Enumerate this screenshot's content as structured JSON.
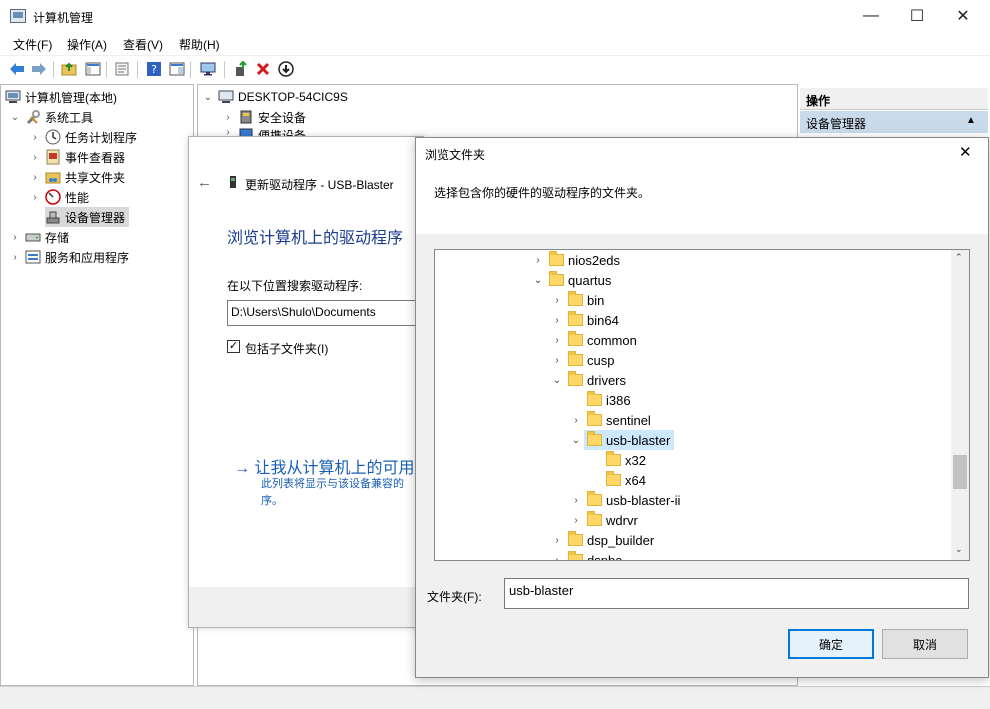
{
  "window": {
    "title": "计算机管理",
    "min_glyph": "—",
    "max_glyph": "☐",
    "close_glyph": "✕"
  },
  "menu": [
    "文件(F)",
    "操作(A)",
    "查看(V)",
    "帮助(H)"
  ],
  "left_tree": {
    "root": "计算机管理(本地)",
    "system_tools": "系统工具",
    "task_scheduler": "任务计划程序",
    "event_viewer": "事件查看器",
    "shared_folders": "共享文件夹",
    "performance": "性能",
    "device_manager": "设备管理器",
    "storage": "存储",
    "services_apps": "服务和应用程序"
  },
  "middle_tree": {
    "computer": "DESKTOP-54CIC9S",
    "security_devices": "安全设备",
    "portable_devices": "便携设备"
  },
  "actions": {
    "header": "操作",
    "device_manager": "设备管理器"
  },
  "wizard": {
    "title": "更新驱动程序 - USB-Blaster",
    "heading": "浏览计算机上的驱动程序",
    "search_label": "在以下位置搜索驱动程序:",
    "path_value": "D:\\Users\\Shulo\\Documents",
    "include_subfolders": "包括子文件夹(I)",
    "pick_link": "→ 让我从计算机上的可用",
    "pick_desc_1": "此列表将显示与该设备兼容的",
    "pick_desc_2": "序。"
  },
  "browse": {
    "title": "浏览文件夹",
    "close_glyph": "✕",
    "instruction": "选择包含你的硬件的驱动程序的文件夹。",
    "folder_label": "文件夹(F):",
    "folder_value": "usb-blaster",
    "ok": "确定",
    "cancel": "取消",
    "tree": [
      {
        "label": "nios2eds",
        "level": 0,
        "chev": "›"
      },
      {
        "label": "quartus",
        "level": 0,
        "chev": "⌄"
      },
      {
        "label": "bin",
        "level": 1,
        "chev": "›"
      },
      {
        "label": "bin64",
        "level": 1,
        "chev": "›"
      },
      {
        "label": "common",
        "level": 1,
        "chev": "›"
      },
      {
        "label": "cusp",
        "level": 1,
        "chev": "›"
      },
      {
        "label": "drivers",
        "level": 1,
        "chev": "⌄"
      },
      {
        "label": "i386",
        "level": 2,
        "chev": ""
      },
      {
        "label": "sentinel",
        "level": 2,
        "chev": "›"
      },
      {
        "label": "usb-blaster",
        "level": 2,
        "chev": "⌄",
        "selected": true
      },
      {
        "label": "x32",
        "level": 3,
        "chev": ""
      },
      {
        "label": "x64",
        "level": 3,
        "chev": ""
      },
      {
        "label": "usb-blaster-ii",
        "level": 2,
        "chev": "›"
      },
      {
        "label": "wdrvr",
        "level": 2,
        "chev": "›"
      },
      {
        "label": "dsp_builder",
        "level": 1,
        "chev": "›"
      },
      {
        "label": "dspba",
        "level": 1,
        "chev": "›"
      }
    ]
  }
}
